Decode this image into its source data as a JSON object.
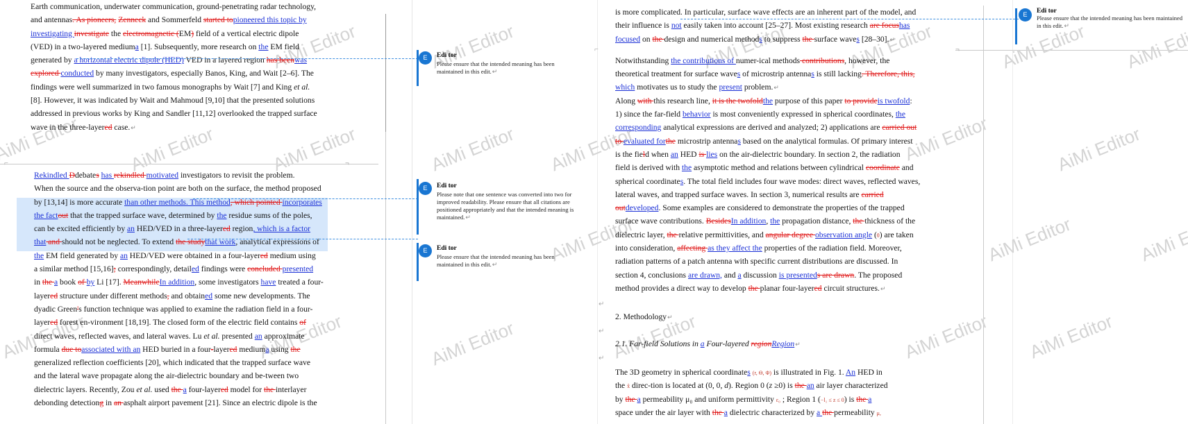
{
  "watermark": "AiMi Editor",
  "comment_author": "Edi tor",
  "comment_avatar": "E",
  "return_mark": "↵",
  "comments": [
    {
      "text": "Please ensure that the intended meaning has been maintained in this edit."
    },
    {
      "text": "Please note that one sentence was converted into two for improved readability. Please ensure that all citations are positioned appropriately and that the intended meaning is maintained."
    },
    {
      "text": "Please ensure that the intended meaning has been maintained in this edit."
    },
    {
      "text": "Please ensure that the intended meaning has been maintained in this edit."
    }
  ],
  "left_top_lines": [
    [
      {
        "t": "Earth communication, underwater communication, ground-penetrating radar technology,"
      }
    ],
    [
      {
        "t": "and antennas"
      },
      {
        "t": ". As pioneers,",
        "k": "d"
      },
      {
        "t": " "
      },
      {
        "t": "Zenneck",
        "k": "d"
      },
      {
        "t": " and Sommerfeld "
      },
      {
        "t": "started to",
        "k": "d"
      },
      {
        "t": "pioneered this topic by",
        "k": "i"
      }
    ],
    [
      {
        "t": "investigating ",
        "k": "i"
      },
      {
        "t": " investigate",
        "k": "d"
      },
      {
        "t": " the "
      },
      {
        "t": "electromagnetic (",
        "k": "d"
      },
      {
        "t": "EM"
      },
      {
        "t": ")",
        "k": "d"
      },
      {
        "t": " field of a vertical electric dipole"
      }
    ],
    [
      {
        "t": "(VED) in a two-layered medium"
      },
      {
        "t": "a",
        "k": "i"
      },
      {
        "t": " [1]. Subsequently, more research on "
      },
      {
        "t": "the",
        "k": "i"
      },
      {
        "t": " EM field"
      }
    ],
    [
      {
        "t": "generated by "
      },
      {
        "t": "a horizontal electric dipole (HED)",
        "k": "i"
      },
      {
        "t": " VED in a layered region "
      },
      {
        "t": "has been",
        "k": "d"
      },
      {
        "t": "was",
        "k": "i"
      }
    ],
    [
      {
        "t": "explored ",
        "k": "d"
      },
      {
        "t": "conducted",
        "k": "i"
      },
      {
        "t": " by many investigators, especially Banos, King, and Wait [2–6]. The"
      }
    ],
    [
      {
        "t": "findings were well summarized in two famous monographs by Wait [7] and King "
      },
      {
        "t": "et al.",
        "k": "em"
      }
    ],
    [
      {
        "t": "[8]. However, it was indicated by Wait and Mahmoud [9,10] that the presented solutions"
      }
    ],
    [
      {
        "t": "addressed in previous works by King and Sandler [11,12] overlooked the trapped surface"
      }
    ],
    [
      {
        "t": "wave in the three-layer"
      },
      {
        "t": "ed",
        "k": "d"
      },
      {
        "t": " case."
      }
    ]
  ],
  "left_bottom_lines": [
    [
      {
        "t": "     "
      },
      {
        "t": "Rekindled ",
        "k": "i"
      },
      {
        "t": "D",
        "k": "d"
      },
      {
        "t": "debate"
      },
      {
        "t": "s",
        "k": "d"
      },
      {
        "t": " "
      },
      {
        "t": "has ",
        "k": "i"
      },
      {
        "t": "rekindled ",
        "k": "d"
      },
      {
        "t": "motivated",
        "k": "i"
      },
      {
        "t": " investigators to revisit the problem."
      }
    ],
    [
      {
        "t": "When the source and the observa-tion point are both on the surface, the method proposed"
      }
    ],
    [
      {
        "t": "by [13,14] is more accurate "
      },
      {
        "t": "than other methods. This method",
        "k": "i"
      },
      {
        "t": ", which pointed ",
        "k": "d"
      },
      {
        "t": "incorporates",
        "k": "i"
      }
    ],
    [
      {
        "t": "the fact",
        "k": "i"
      },
      {
        "t": "out",
        "k": "d"
      },
      {
        "t": " that the trapped surface wave, determined by "
      },
      {
        "t": "the",
        "k": "i"
      },
      {
        "t": " residue sums of the poles,"
      }
    ],
    [
      {
        "t": "can be excited efficiently by "
      },
      {
        "t": "an",
        "k": "i"
      },
      {
        "t": " HED/VED in a three-layer"
      },
      {
        "t": "ed",
        "k": "d"
      },
      {
        "t": " region"
      },
      {
        "t": ", which is a factor",
        "k": "i"
      }
    ],
    [
      {
        "t": "that",
        "k": "i"
      },
      {
        "t": " and ",
        "k": "d"
      },
      {
        "t": " should not be neglected. To extend "
      },
      {
        "t": "the study",
        "k": "d"
      },
      {
        "t": "that work",
        "k": "i"
      },
      {
        "t": ", analytical expressions of"
      }
    ],
    [
      {
        "t": "the",
        "k": "i"
      },
      {
        "t": " EM field generated by "
      },
      {
        "t": "an",
        "k": "i"
      },
      {
        "t": " HED/VED were obtained in a four-layer"
      },
      {
        "t": "ed",
        "k": "d"
      },
      {
        "t": " medium using"
      }
    ],
    [
      {
        "t": "a similar method [15,16]"
      },
      {
        "t": ";",
        "k": "d"
      },
      {
        "t": " correspondingly, detail"
      },
      {
        "t": "ed",
        "k": "i"
      },
      {
        "t": " findings were "
      },
      {
        "t": "concluded ",
        "k": "d"
      },
      {
        "t": "presented",
        "k": "i"
      }
    ],
    [
      {
        "t": "in "
      },
      {
        "t": "the ",
        "k": "d"
      },
      {
        "t": "a",
        "k": "i"
      },
      {
        "t": " book "
      },
      {
        "t": "of ",
        "k": "d"
      },
      {
        "t": "by",
        "k": "i"
      },
      {
        "t": " Li [17]. "
      },
      {
        "t": "Meanwhile",
        "k": "d"
      },
      {
        "t": "In addition",
        "k": "i"
      },
      {
        "t": ", some investigators "
      },
      {
        "t": "have",
        "k": "i"
      },
      {
        "t": " treated a four-"
      }
    ],
    [
      {
        "t": "layer"
      },
      {
        "t": "ed",
        "k": "d"
      },
      {
        "t": " structure under different methods"
      },
      {
        "t": ",",
        "k": "d"
      },
      {
        "t": " and obtain"
      },
      {
        "t": "ed",
        "k": "i"
      },
      {
        "t": " some new developments. The"
      }
    ],
    [
      {
        "t": "dyadic Green"
      },
      {
        "t": "'",
        "k": "d"
      },
      {
        "t": "s function technique was applied to examine the radiation field in a four-"
      }
    ],
    [
      {
        "t": "layer"
      },
      {
        "t": "ed",
        "k": "d"
      },
      {
        "t": " forest en-vironment [18,19]. The closed form of the electric field contains "
      },
      {
        "t": "of",
        "k": "d"
      }
    ],
    [
      {
        "t": "direct waves, reflected waves, and lateral waves. Lu "
      },
      {
        "t": "et al.",
        "k": "em"
      },
      {
        "t": " presented "
      },
      {
        "t": "an",
        "k": "i"
      },
      {
        "t": " approximate"
      }
    ],
    [
      {
        "t": "formula "
      },
      {
        "t": "due to",
        "k": "d"
      },
      {
        "t": "associated with an",
        "k": "i"
      },
      {
        "t": " HED buried in a four"
      },
      {
        "t": "-",
        "k": "d"
      },
      {
        "t": "layer"
      },
      {
        "t": "ed",
        "k": "d"
      },
      {
        "t": " medium"
      },
      {
        "t": "a",
        "k": "i"
      },
      {
        "t": " using "
      },
      {
        "t": "the",
        "k": "d"
      }
    ],
    [
      {
        "t": "generalized reflection coefficients [20], which indicated that the trapped surface wave"
      }
    ],
    [
      {
        "t": "and the lateral wave propagate along the air-dielectric boundary and be-tween two"
      }
    ],
    [
      {
        "t": "dielectric layers. Recently, Zou "
      },
      {
        "t": "et al.",
        "k": "em"
      },
      {
        "t": " used "
      },
      {
        "t": "the ",
        "k": "d"
      },
      {
        "t": "a",
        "k": "i"
      },
      {
        "t": " four-layer"
      },
      {
        "t": "ed",
        "k": "d"
      },
      {
        "t": " model for "
      },
      {
        "t": "the ",
        "k": "d"
      },
      {
        "t": "interlayer"
      }
    ],
    [
      {
        "t": "debonding detection"
      },
      {
        "t": "g",
        "k": "d"
      },
      {
        "t": " in "
      },
      {
        "t": "an ",
        "k": "d"
      },
      {
        "t": "asphalt airport pavement [21]. Since an electric dipole is the"
      }
    ]
  ],
  "right_lines": [
    [
      {
        "t": "is more complicated. In particular, surface wave effects are an inherent part of the model, and"
      }
    ],
    [
      {
        "t": "their influence is "
      },
      {
        "t": "not",
        "k": "i"
      },
      {
        "t": " easily taken into account [25–27]. Most existing research "
      },
      {
        "t": "are focus",
        "k": "d"
      },
      {
        "t": "has",
        "k": "i"
      }
    ],
    [
      {
        "t": "focused",
        "k": "i"
      },
      {
        "t": " on "
      },
      {
        "t": "the ",
        "k": "d"
      },
      {
        "t": "design and numerical method"
      },
      {
        "t": "s",
        "k": "i"
      },
      {
        "t": " to suppress "
      },
      {
        "t": "the ",
        "k": "d"
      },
      {
        "t": "surface wave"
      },
      {
        "t": "s",
        "k": "i"
      },
      {
        "t": " [28–30]."
      }
    ],
    [
      {
        "t": "Notwithstanding "
      },
      {
        "t": "the contributions of ",
        "k": "i"
      },
      {
        "t": " numer-ical methods"
      },
      {
        "t": " contributions",
        "k": "d"
      },
      {
        "t": ", however, the"
      }
    ],
    [
      {
        "t": "theoretical treatment for surface wave"
      },
      {
        "t": "s",
        "k": "i"
      },
      {
        "t": " of microstrip antenna"
      },
      {
        "t": "s",
        "k": "i"
      },
      {
        "t": " is still lacking"
      },
      {
        "t": ". Therefore, this,",
        "k": "d"
      }
    ],
    [
      {
        "t": "which",
        "k": "i"
      },
      {
        "t": " motivates us to study the "
      },
      {
        "t": "present",
        "k": "i"
      },
      {
        "t": " problem."
      }
    ],
    [
      {
        "t": "     Along "
      },
      {
        "t": "with ",
        "k": "d"
      },
      {
        "t": "this research line, "
      },
      {
        "t": "it is the twofold",
        "k": "d"
      },
      {
        "t": "the",
        "k": "i"
      },
      {
        "t": " purpose of this paper "
      },
      {
        "t": "to provide",
        "k": "d"
      },
      {
        "t": "is twofold",
        "k": "i"
      },
      {
        "t": ":"
      }
    ],
    [
      {
        "t": "1) since the far-field "
      },
      {
        "t": "behavior",
        "k": "i"
      },
      {
        "t": " is most conveniently expressed in spherical coordinates, "
      },
      {
        "t": "the",
        "k": "i"
      }
    ],
    [
      {
        "t": "corresponding",
        "k": "i"
      },
      {
        "t": " analytical expressions are derived and analyzed; 2) applications are "
      },
      {
        "t": "carried out",
        "k": "d"
      }
    ],
    [
      {
        "t": "to ",
        "k": "d"
      },
      {
        "t": "evaluated for",
        "k": "i"
      },
      {
        "t": "the",
        "k": "d"
      },
      {
        "t": " microstrip antenna"
      },
      {
        "t": "s",
        "k": "i"
      },
      {
        "t": " based on the analytical formulas. Of primary interest"
      }
    ],
    [
      {
        "t": "is the fie"
      },
      {
        "t": "l",
        "k": "d"
      },
      {
        "t": "d when "
      },
      {
        "t": "an",
        "k": "i"
      },
      {
        "t": " HED "
      },
      {
        "t": "is ",
        "k": "d"
      },
      {
        "t": "lies",
        "k": "i"
      },
      {
        "t": " on the air-dielectric boundary. In section 2, the radiation"
      }
    ],
    [
      {
        "t": "field is derived with "
      },
      {
        "t": "the",
        "k": "i"
      },
      {
        "t": " asymptotic method and relations between cylindrical "
      },
      {
        "t": "coordinate",
        "k": "d"
      },
      {
        "t": " and"
      }
    ],
    [
      {
        "t": "spherical coordinate"
      },
      {
        "t": "s",
        "k": "i"
      },
      {
        "t": ". The total field includes four wave modes: direct waves, reflected waves,"
      }
    ],
    [
      {
        "t": "lateral waves, and trapped surface waves. In section 3, numerical results are "
      },
      {
        "t": "carried",
        "k": "d"
      }
    ],
    [
      {
        "t": "out",
        "k": "d"
      },
      {
        "t": "developed",
        "k": "i"
      },
      {
        "t": ". Some examples are considered to demonstrate the properties of the trapped"
      }
    ],
    [
      {
        "t": "surface wave contributions. "
      },
      {
        "t": "Besides",
        "k": "d"
      },
      {
        "t": "In addition",
        "k": "i"
      },
      {
        "t": ", "
      },
      {
        "t": "the",
        "k": "i"
      },
      {
        "t": " propagation distance, "
      },
      {
        "t": "the ",
        "k": "d"
      },
      {
        "t": "thickness of the"
      }
    ],
    [
      {
        "t": "dielectric layer, "
      },
      {
        "t": "the ",
        "k": "d"
      },
      {
        "t": "relative permittivities, and "
      },
      {
        "t": "angular degree ",
        "k": "d"
      },
      {
        "t": "observation angle",
        "k": "i"
      },
      {
        "t": " ("
      },
      {
        "t": "θ",
        "k": "sym"
      },
      {
        "t": ") are taken"
      }
    ],
    [
      {
        "t": "into consideration, "
      },
      {
        "t": "affecting ",
        "k": "d"
      },
      {
        "t": "as they affect the",
        "k": "i"
      },
      {
        "t": " properties of the radiation field. Moreover,"
      }
    ],
    [
      {
        "t": "radiation patterns of a patch antenna with specific current distributions are discussed. In"
      }
    ],
    [
      {
        "t": "section 4, conclusions "
      },
      {
        "t": "are drawn,",
        "k": "i"
      },
      {
        "t": " and "
      },
      {
        "t": "a",
        "k": "i"
      },
      {
        "t": " discussion "
      },
      {
        "t": "is presented",
        "k": "i"
      },
      {
        "t": "s are drawn",
        "k": "d"
      },
      {
        "t": ". The proposed"
      }
    ],
    [
      {
        "t": "method provides a direct way to develop "
      },
      {
        "t": "the ",
        "k": "d"
      },
      {
        "t": "planar four-layer"
      },
      {
        "t": "ed",
        "k": "d"
      },
      {
        "t": " circuit structures."
      }
    ]
  ],
  "section_heading": "2. Methodology",
  "subsection_heading": [
    {
      "t": "2.1. Far-field Solutions in ",
      "k": "em"
    },
    {
      "t": "a",
      "k": "ie"
    },
    {
      "t": " Four-layered ",
      "k": "em"
    },
    {
      "t": "region",
      "k": "de"
    },
    {
      "t": "Region",
      "k": "ie"
    }
  ],
  "right_tail_lines": [
    [
      {
        "t": "The 3D geometry in spherical coordinate"
      },
      {
        "t": "s",
        "k": "i"
      },
      {
        "t": " "
      },
      {
        "t": "(r, Θ, Φ)",
        "k": "sym"
      },
      {
        "t": " is illustrated in Fig. 1. "
      },
      {
        "t": "An",
        "k": "i"
      },
      {
        "t": " HED in"
      }
    ],
    [
      {
        "t": "the "
      },
      {
        "t": "x̂",
        "k": "sym"
      },
      {
        "t": " direc-tion is located at (0, 0, "
      },
      {
        "t": "d",
        "k": "em"
      },
      {
        "t": "). Region 0 ("
      },
      {
        "t": "z",
        "k": "em"
      },
      {
        "t": " ≥0) is "
      },
      {
        "t": "the ",
        "k": "d"
      },
      {
        "t": "an",
        "k": "i"
      },
      {
        "t": " air layer characterized"
      }
    ],
    [
      {
        "t": "by "
      },
      {
        "t": "the ",
        "k": "d"
      },
      {
        "t": "a",
        "k": "i"
      },
      {
        "t": " permeability μ₀ and uniform permittivity "
      },
      {
        "t": "ε₀",
        "k": "sym"
      },
      {
        "t": " ; Region 1 ("
      },
      {
        "t": "−l₁ ≤ z ≤ 0",
        "k": "sym"
      },
      {
        "t": ") is "
      },
      {
        "t": "the ",
        "k": "d"
      },
      {
        "t": "a",
        "k": "i"
      }
    ],
    [
      {
        "t": "space under the air layer with "
      },
      {
        "t": "the ",
        "k": "d"
      },
      {
        "t": "a",
        "k": "i"
      },
      {
        "t": " dielectric characterized by "
      },
      {
        "t": "a ",
        "k": "i"
      },
      {
        "t": "the ",
        "k": "d"
      },
      {
        "t": "permeability "
      },
      {
        "t": "μ,",
        "k": "sym"
      }
    ]
  ]
}
